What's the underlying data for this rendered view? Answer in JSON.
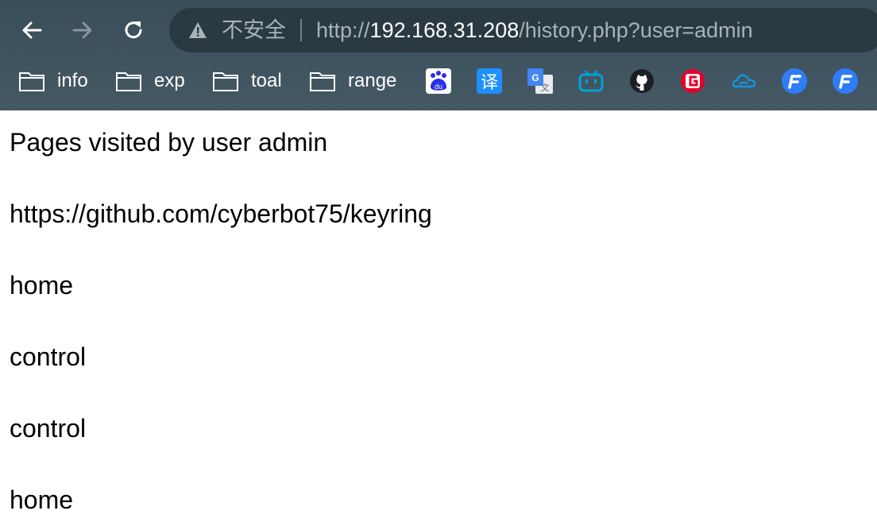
{
  "toolbar": {
    "security_label": "不安全",
    "url_scheme": "http://",
    "url_host": "192.168.31.208",
    "url_path": "/history.php?user=admin"
  },
  "bookmarks": {
    "folders": [
      {
        "label": "info"
      },
      {
        "label": "exp"
      },
      {
        "label": "toal"
      },
      {
        "label": "range"
      }
    ],
    "icons": [
      "baidu-icon",
      "translate-icon",
      "google-translate-icon",
      "bilibili-icon",
      "github-icon",
      "g-red-icon",
      "cloud-icon",
      "f-blue-icon",
      "f-blue-icon-2"
    ],
    "translate_glyph": "译",
    "baidu_glyph": "du"
  },
  "page": {
    "heading": "Pages visited by user admin",
    "entries": [
      "https://github.com/cyberbot75/keyring",
      "home",
      "control",
      "control",
      "home"
    ]
  },
  "colors": {
    "chrome_bg": "#3c4f5c",
    "omnibox_bg": "#2b3942",
    "url_dim": "#a9b3b9",
    "url_host": "#ffffff"
  }
}
